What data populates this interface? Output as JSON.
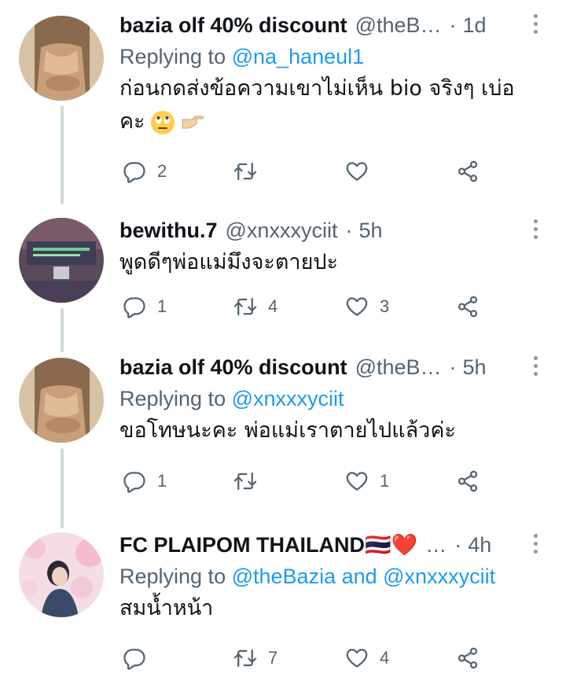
{
  "tweets": [
    {
      "name": "bazia olf 40% discount",
      "handle": "@theB…",
      "time": "1d",
      "replying_prefix": "Replying to",
      "replying_to": "@na_haneul1",
      "text_line1": "ก่อนกดส่งข้อความเขาไม่เห็น bio จริงๆ เบ่อ",
      "text_line2": "คะ",
      "emojis": [
        "face-with-rolling-eyes-emoji",
        "hand-pointing-right-emoji"
      ],
      "counts": {
        "replies": "2",
        "retweets": "",
        "likes": ""
      }
    },
    {
      "name": "bewithu.7",
      "handle": "@xnxxxyciit",
      "time": "5h",
      "text_line1": "พูดดีๆพ่อแม่มึงจะตายปะ",
      "counts": {
        "replies": "1",
        "retweets": "4",
        "likes": "3"
      }
    },
    {
      "name": "bazia olf 40% discount",
      "handle": "@theB…",
      "time": "5h",
      "replying_prefix": "Replying to",
      "replying_to": "@xnxxxyciit",
      "text_line1": "ขอโทษนะคะ พ่อแม่เราตายไปแล้วค่ะ",
      "counts": {
        "replies": "1",
        "retweets": "",
        "likes": "1"
      }
    },
    {
      "name": "FC PLAIPOM THAILAND🇹🇭❤️",
      "handle": "…",
      "time": "4h",
      "replying_prefix": "Replying to",
      "replying_to": "@theBazia and @xnxxxyciit",
      "text_line1": "สมน้ำหน้า",
      "counts": {
        "replies": "",
        "retweets": "7",
        "likes": "4"
      }
    }
  ],
  "colors": {
    "link": "#1d9bf0",
    "muted": "#536471",
    "thread_line": "#cfd9de"
  }
}
